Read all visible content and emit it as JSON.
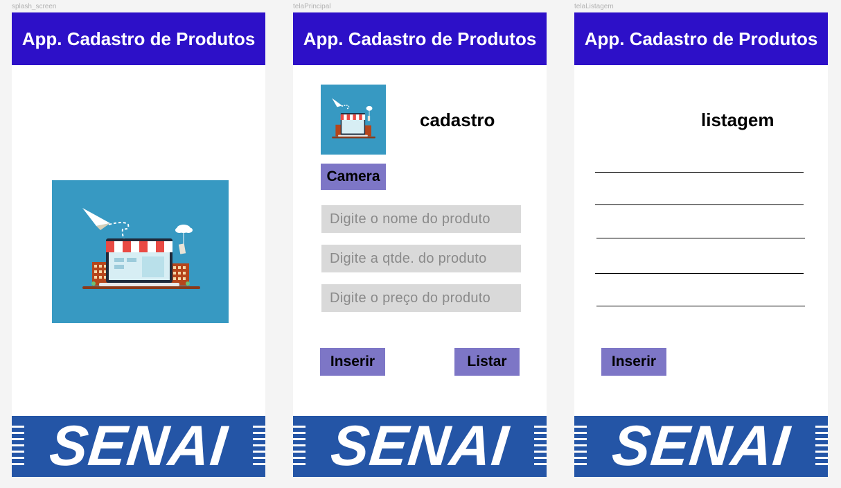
{
  "frames": {
    "splash": {
      "label": "splash_screen"
    },
    "principal": {
      "label": "telaPrincipal"
    },
    "listagem": {
      "label": "telaListagem"
    }
  },
  "header": {
    "title": "App. Cadastro de Produtos"
  },
  "footer": {
    "logo_text": "SENAI"
  },
  "principal": {
    "heading": "cadastro",
    "camera_label": "Camera",
    "fields": {
      "nome_placeholder": "Digite o nome do produto",
      "qtde_placeholder": "Digite a qtde. do produto",
      "preco_placeholder": "Digite o preço do produto"
    },
    "inserir_label": "Inserir",
    "listar_label": "Listar"
  },
  "listagem": {
    "heading": "listagem",
    "rows": [
      "",
      "",
      "",
      "",
      ""
    ],
    "inserir_label": "Inserir"
  },
  "colors": {
    "header_bg": "#2d10c8",
    "footer_bg": "#2455a6",
    "button_bg": "#7d76c6",
    "field_bg": "#d9d9d9",
    "illustration_bg": "#3799c2"
  },
  "icons": {
    "illustration": "online-shop-laptop-icon"
  }
}
